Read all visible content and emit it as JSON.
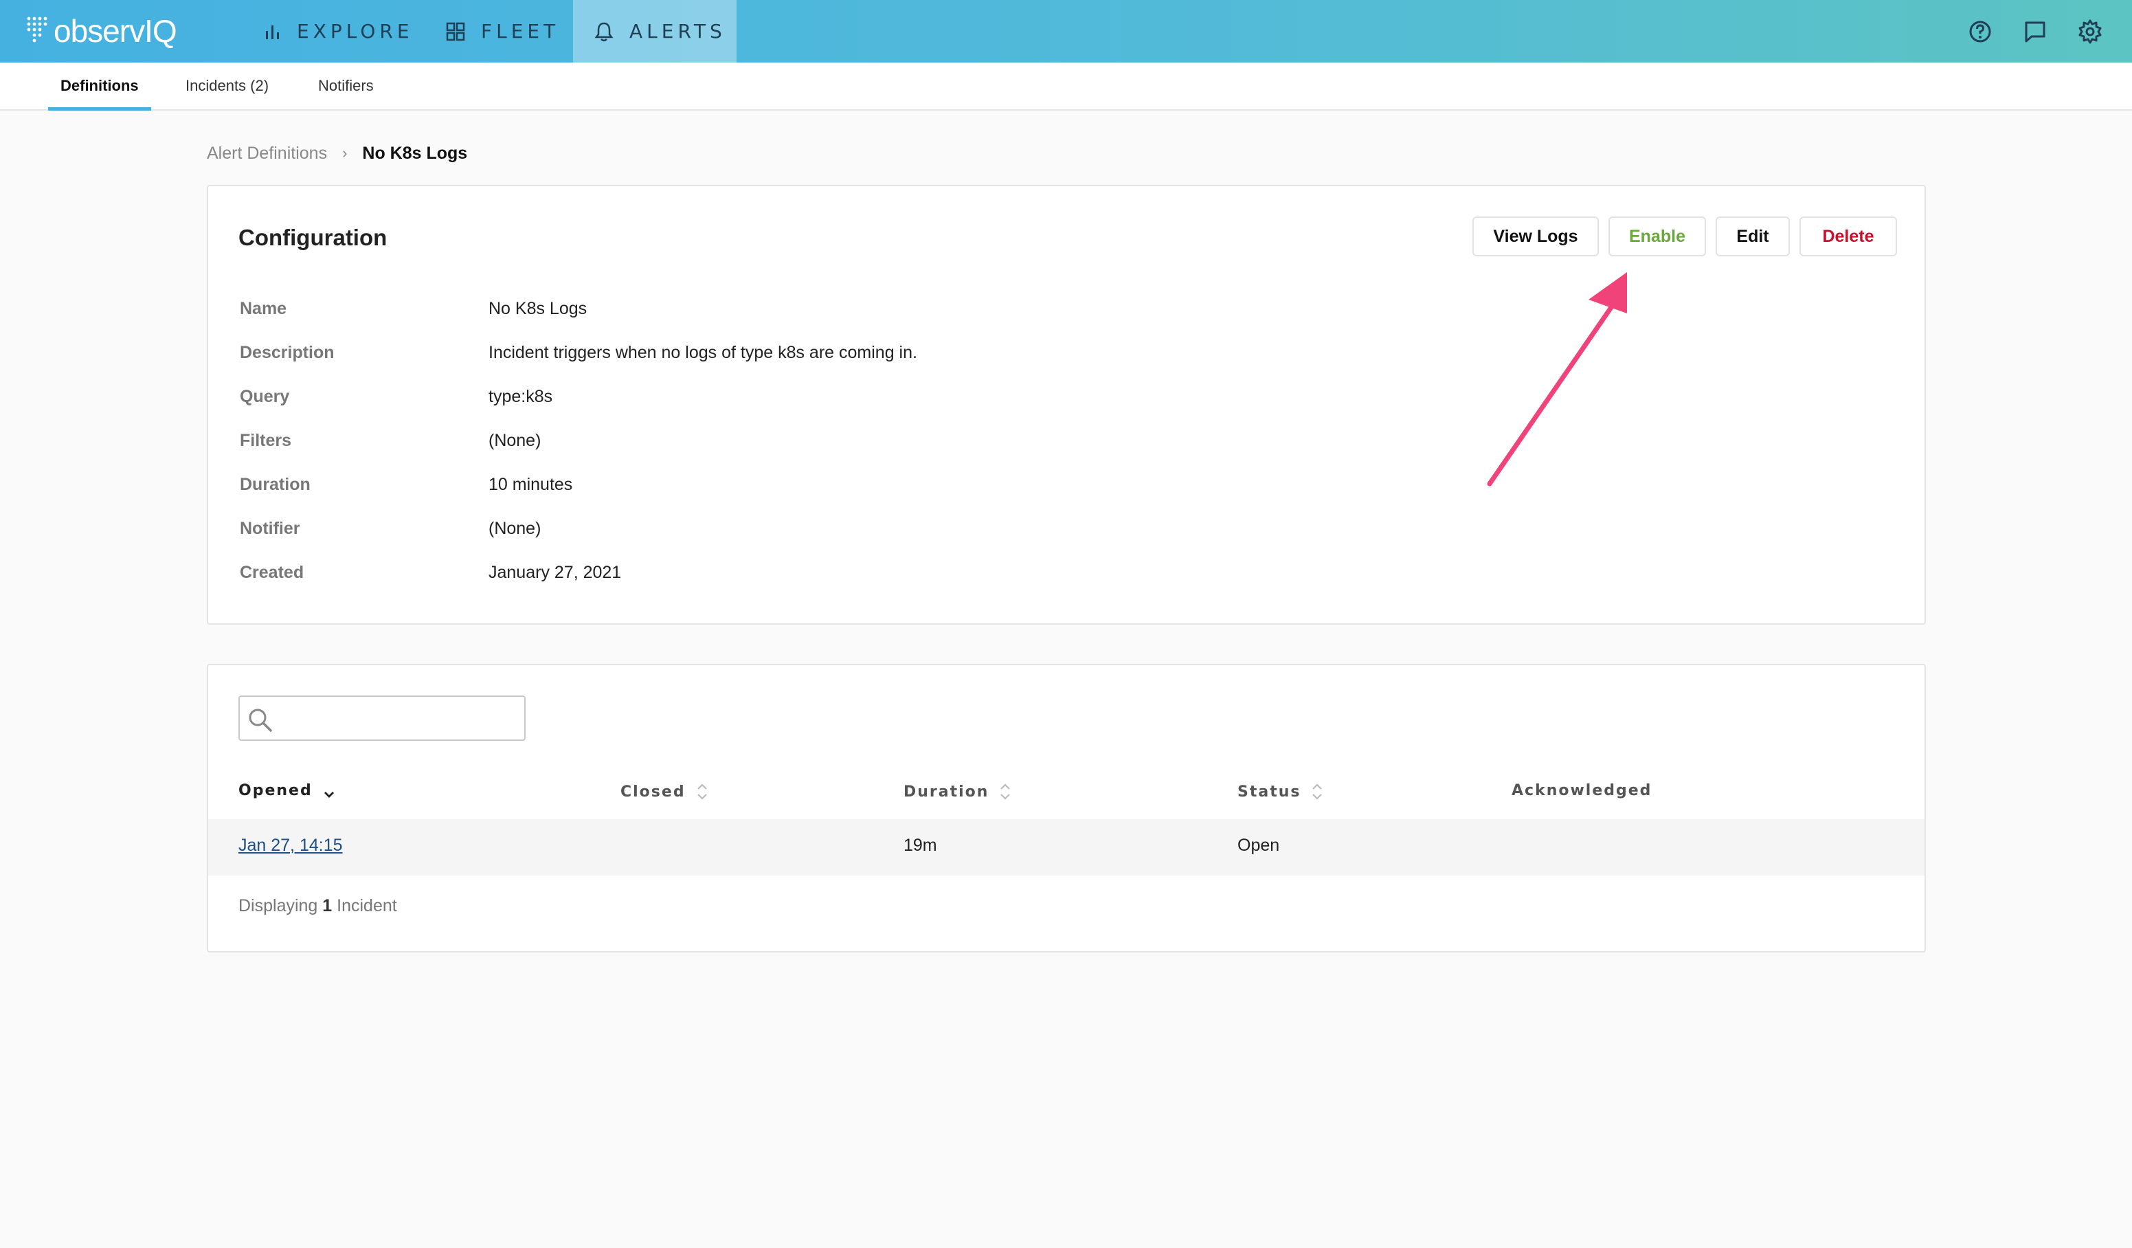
{
  "brand": {
    "logo_text": "observIQ"
  },
  "colors": {
    "nav_gradient_start": "#45b1e1",
    "nav_gradient_end": "#5cc4c2",
    "enable": "#6aa83b",
    "delete": "#c8102e",
    "link": "#1f4f85",
    "arrow": "#f0437a"
  },
  "topnav": {
    "items": [
      {
        "label": "EXPLORE",
        "icon": "bar-chart-icon"
      },
      {
        "label": "FLEET",
        "icon": "grid-icon"
      },
      {
        "label": "ALERTS",
        "icon": "bell-icon",
        "active": true
      }
    ],
    "right_icons": [
      "help-icon",
      "chat-icon",
      "settings-icon"
    ]
  },
  "subnav": {
    "tabs": [
      {
        "label": "Definitions",
        "active": true
      },
      {
        "label": "Incidents (2)"
      },
      {
        "label": "Notifiers"
      }
    ]
  },
  "breadcrumb": {
    "parent": "Alert Definitions",
    "separator": "›",
    "current": "No K8s Logs"
  },
  "config": {
    "title": "Configuration",
    "buttons": {
      "view_logs": "View Logs",
      "enable": "Enable",
      "edit": "Edit",
      "delete": "Delete"
    },
    "fields": [
      {
        "label": "Name",
        "value": "No K8s Logs"
      },
      {
        "label": "Description",
        "value": "Incident triggers when no logs of type k8s are coming in."
      },
      {
        "label": "Query",
        "value": "type:k8s"
      },
      {
        "label": "Filters",
        "value": "(None)"
      },
      {
        "label": "Duration",
        "value": "10 minutes"
      },
      {
        "label": "Notifier",
        "value": "(None)"
      },
      {
        "label": "Created",
        "value": "January 27, 2021"
      }
    ]
  },
  "incidents": {
    "search": {
      "value": "",
      "placeholder": ""
    },
    "columns": {
      "opened": "Opened",
      "closed": "Closed",
      "duration": "Duration",
      "status": "Status",
      "acknowledged": "Acknowledged"
    },
    "rows": [
      {
        "opened": "Jan 27, 14:15",
        "closed": "",
        "duration": "19m",
        "status": "Open",
        "acknowledged": ""
      }
    ],
    "footer": {
      "prefix": "Displaying",
      "count": "1",
      "suffix": "Incident"
    }
  }
}
